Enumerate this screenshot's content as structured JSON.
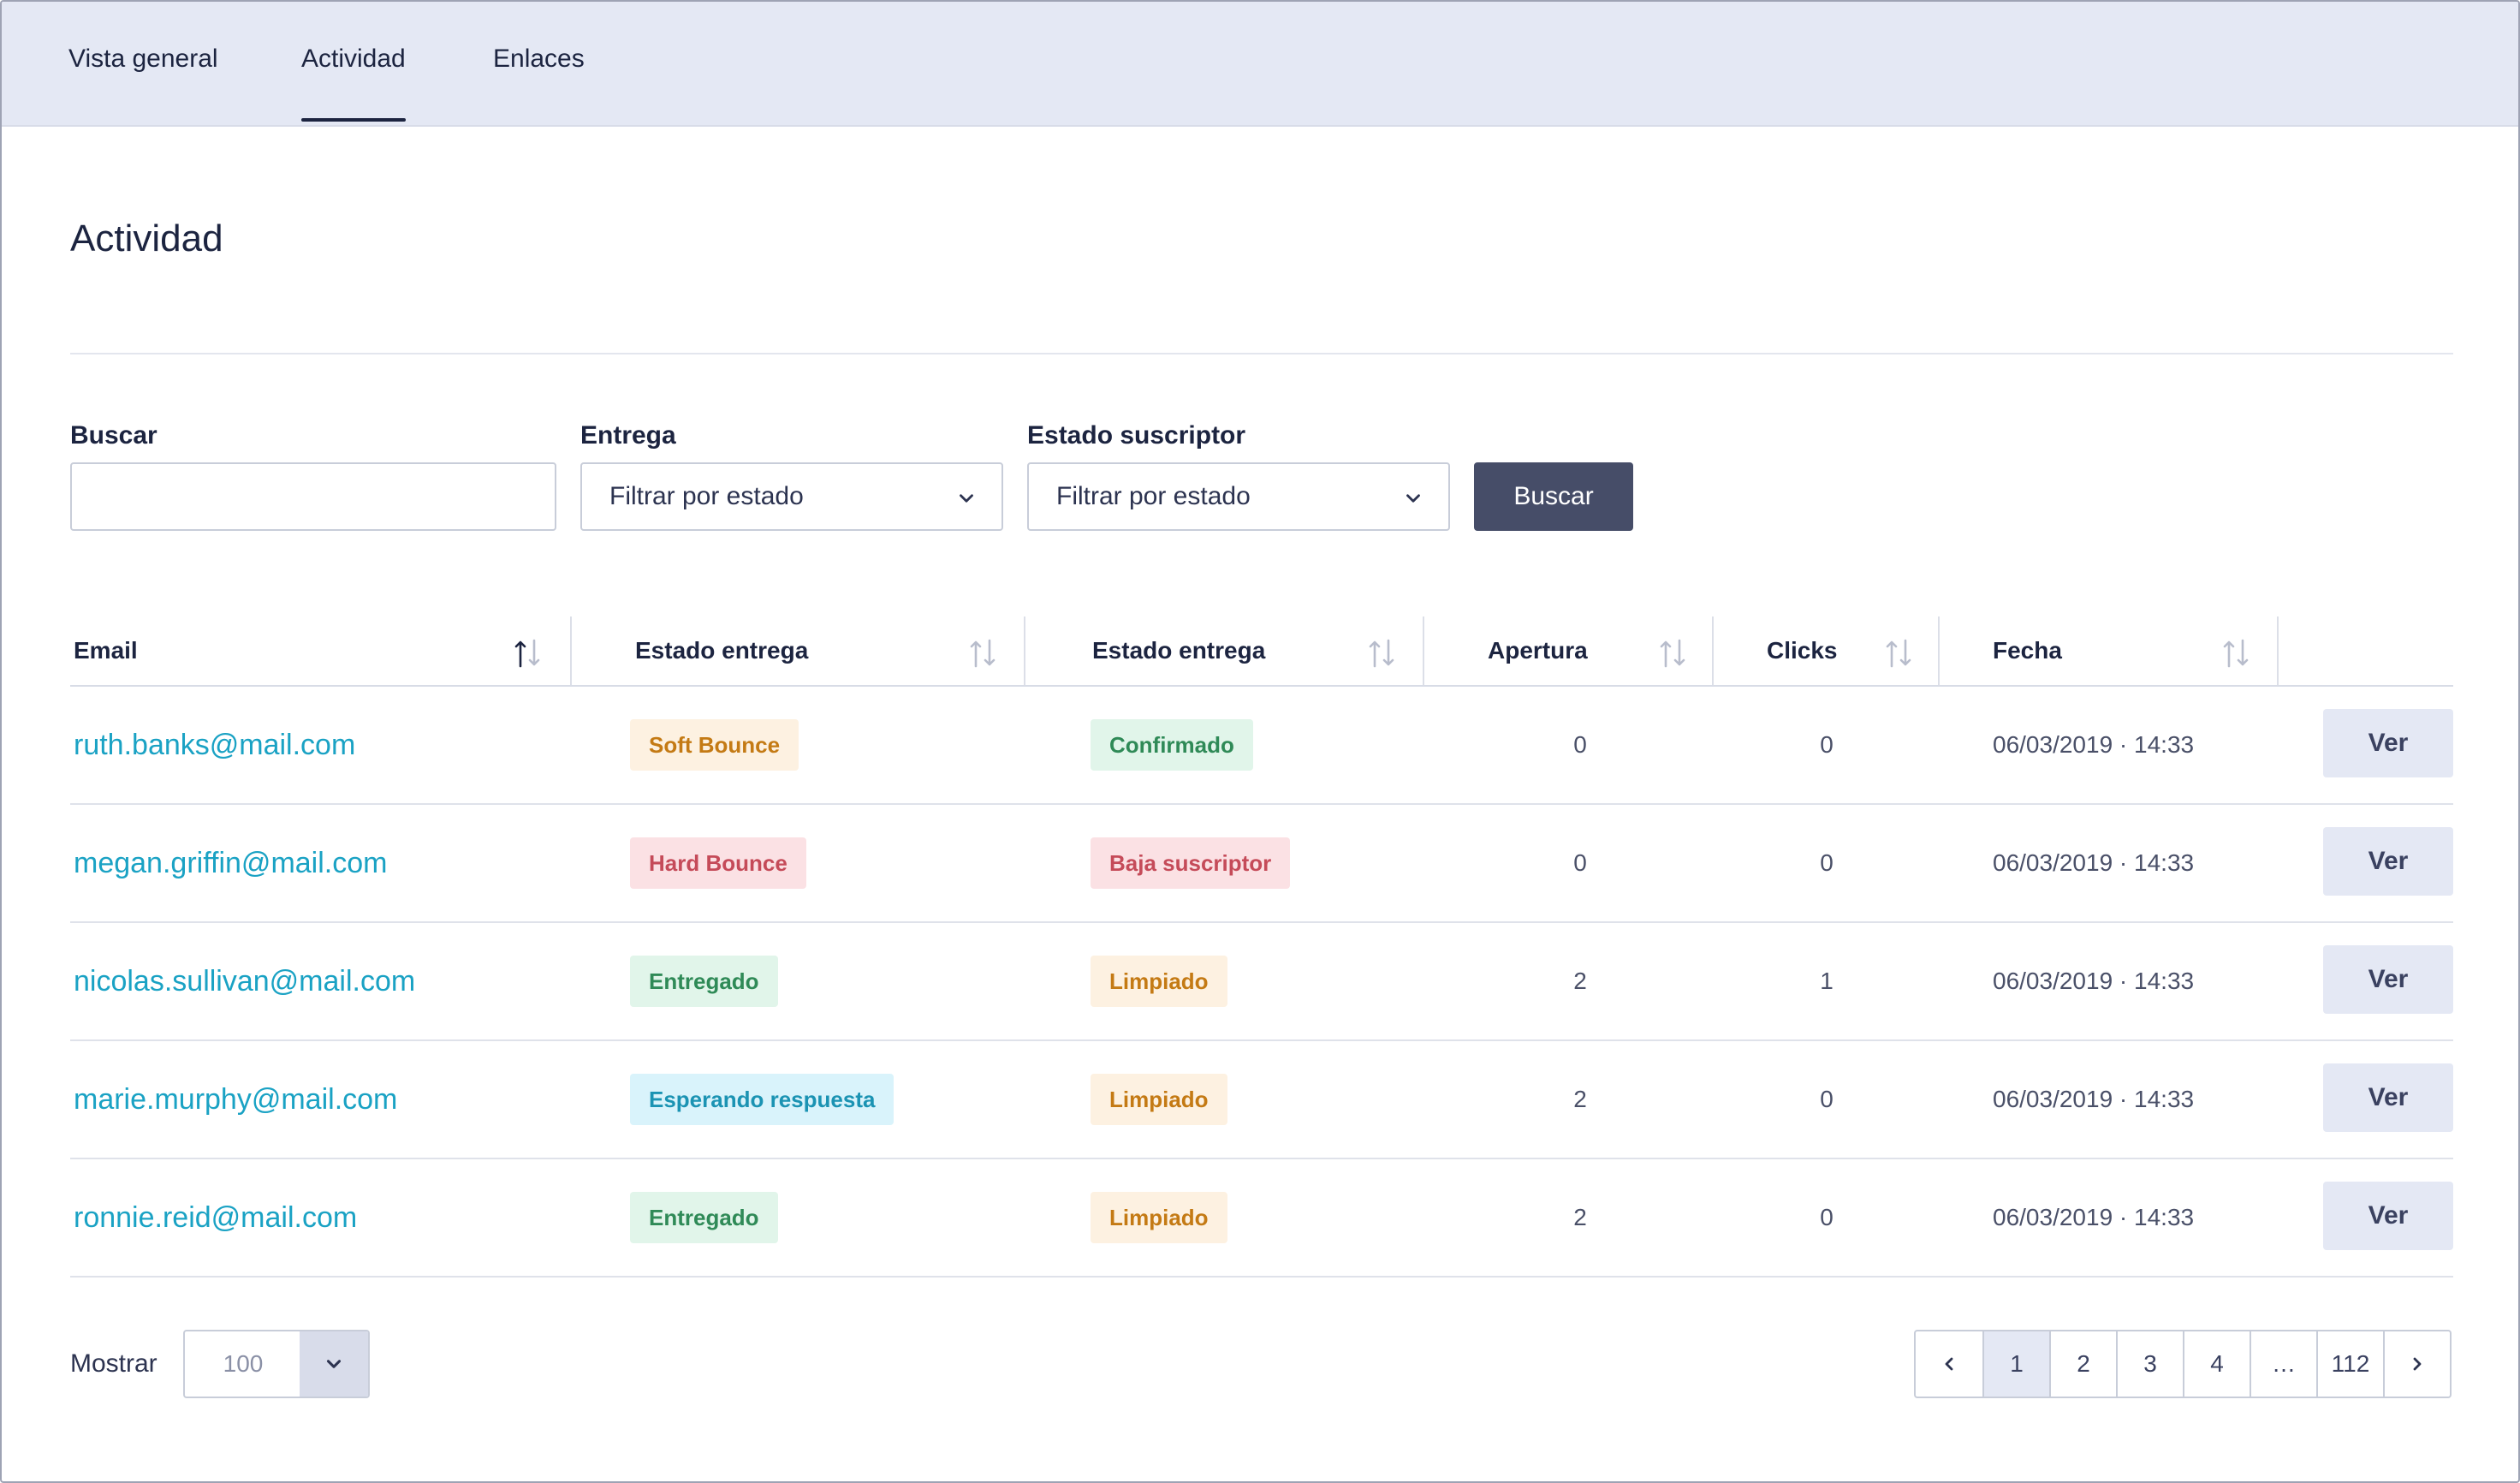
{
  "tabs": [
    {
      "label": "Vista general",
      "active": false
    },
    {
      "label": "Actividad",
      "active": true
    },
    {
      "label": "Enlaces",
      "active": false
    }
  ],
  "page_title": "Actividad",
  "filters": {
    "search_label": "Buscar",
    "search_value": "",
    "delivery_label": "Entrega",
    "delivery_value": "Filtrar por estado",
    "subscriber_label": "Estado suscriptor",
    "subscriber_value": "Filtrar por estado",
    "search_button": "Buscar"
  },
  "table": {
    "columns": [
      "Email",
      "Estado entrega",
      "Estado entrega",
      "Apertura",
      "Clicks",
      "Fecha"
    ],
    "rows": [
      {
        "email": "ruth.banks@mail.com",
        "delivery": "Soft Bounce",
        "delivery_color": "#c47a14",
        "subscriber": "Confirmado",
        "subscriber_color": "#2f8a57",
        "opens": "0",
        "clicks": "0",
        "date": "06/03/2019 · 14:33",
        "action": "Ver"
      },
      {
        "email": "megan.griffin@mail.com",
        "delivery": "Hard Bounce",
        "delivery_color": "#c54b59",
        "subscriber": "Baja suscriptor",
        "subscriber_color": "#c54b59",
        "opens": "0",
        "clicks": "0",
        "date": "06/03/2019 · 14:33",
        "action": "Ver"
      },
      {
        "email": "nicolas.sullivan@mail.com",
        "delivery": "Entregado",
        "delivery_color": "#2f8a57",
        "subscriber": "Limpiado",
        "subscriber_color": "#c47a14",
        "opens": "2",
        "clicks": "1",
        "date": "06/03/2019 · 14:33",
        "action": "Ver"
      },
      {
        "email": "marie.murphy@mail.com",
        "delivery": "Esperando respuesta",
        "delivery_color": "#1b93b3",
        "subscriber": "Limpiado",
        "subscriber_color": "#c47a14",
        "opens": "2",
        "clicks": "0",
        "date": "06/03/2019 · 14:33",
        "action": "Ver"
      },
      {
        "email": "ronnie.reid@mail.com",
        "delivery": "Entregado",
        "delivery_color": "#2f8a57",
        "subscriber": "Limpiado",
        "subscriber_color": "#c47a14",
        "opens": "2",
        "clicks": "0",
        "date": "06/03/2019 · 14:33",
        "action": "Ver"
      }
    ]
  },
  "footer": {
    "show_label": "Mostrar",
    "show_value": "100",
    "pages": [
      "1",
      "2",
      "3",
      "4",
      "…",
      "112"
    ],
    "current_page": "1"
  },
  "colors": {
    "accent": "#464d68",
    "link": "#1aa2c4",
    "tabbar": "#e4e8f4"
  }
}
